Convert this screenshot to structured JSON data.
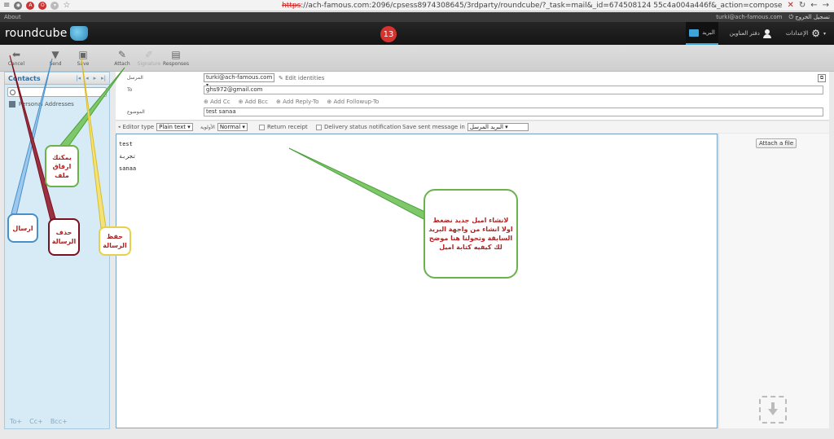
{
  "browser": {
    "url_scheme": "https",
    "url_rest": "://ach-famous.com:2096/cpsess8974308645/3rdparty/roundcube/?_task=mail&_id=674508124 55c4a004a446f&_action=compose"
  },
  "aboutbar": {
    "about": "About",
    "user_email": "turki@ach-famous.com",
    "logout": "تسجيل الخروج"
  },
  "header": {
    "logo_text": "roundcube",
    "badge_number": "13",
    "nav_mail": "البريد",
    "nav_contacts": "دفتر العناوين",
    "nav_settings": "الإعدادات"
  },
  "toolbar": {
    "cancel": "Cancel",
    "send": "Send",
    "save": "Save",
    "attach": "Attach",
    "signature": "Signature",
    "responses": "Responses"
  },
  "contacts": {
    "title": "Contacts",
    "nav_first": "|◂",
    "nav_prev": "◂",
    "nav_next": "▸",
    "nav_last": "▸|",
    "personal_addresses": "Personal Addresses",
    "footer_to": "To+",
    "footer_cc": "Cc+",
    "footer_bcc": "Bcc+"
  },
  "compose": {
    "from_label": "المرسل",
    "from_value": "turki@ach-famous.com",
    "edit_identities": "Edit identities",
    "to_label": "To",
    "to_value": "ghs972@gmail.com",
    "add_cc": "Add Cc",
    "add_bcc": "Add Bcc",
    "add_reply_to": "Add Reply-To",
    "add_followup_to": "Add Followup-To",
    "subject_label": "الموضوع",
    "subject_value": "test sanaa"
  },
  "options": {
    "editor_type_label": "Editor type",
    "editor_type_value": "Plain text",
    "priority_label": "الأولوية",
    "priority_value": "Normal",
    "return_receipt": "Return receipt",
    "delivery_notification": "Delivery status notification",
    "save_sent_label": "Save sent message in",
    "save_sent_value": "البريد المرسل"
  },
  "body": {
    "line1": "test",
    "line2": "تجربة",
    "line3": "sanaa"
  },
  "attachments": {
    "attach_button": "Attach a file"
  },
  "annotations": {
    "attach_note": "يمكنك ارفاق ملف",
    "send_note": "ارسال",
    "delete_note": "حذف الرسالة",
    "save_note": "حفظ الرسالة",
    "main_note": "لانشاء اميل جديد نضغط اولا انشاء من واجهة البريد السابقة وتحولنا هنا موضح لك كيفيه كتابة اميل"
  },
  "colors": {
    "accent": "#3ea3d8",
    "badge": "#d8322f",
    "annotation_red": "#b22222",
    "annotation_green": "#4aa03a",
    "annotation_blue": "#4a90c8",
    "annotation_darkred": "#7a1020",
    "annotation_yellow": "#e8d14a"
  }
}
